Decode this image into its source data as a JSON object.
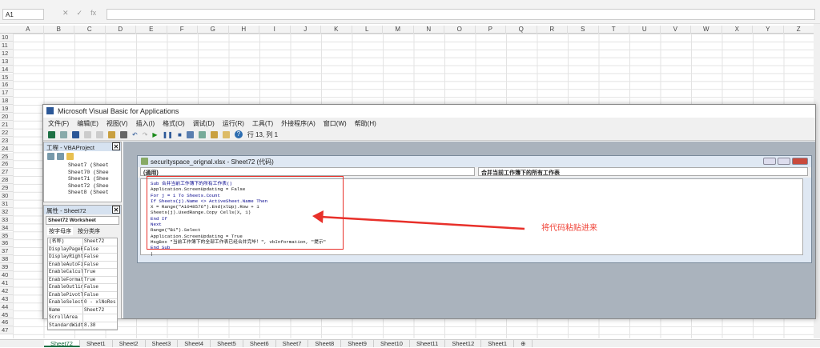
{
  "excel": {
    "name_box": "A1",
    "fx": "fx",
    "columns": [
      "A",
      "B",
      "C",
      "D",
      "E",
      "F",
      "G",
      "H",
      "I",
      "J",
      "K",
      "L",
      "M",
      "N",
      "O",
      "P",
      "Q",
      "R",
      "S",
      "T",
      "U",
      "V",
      "W",
      "X",
      "Y",
      "Z"
    ],
    "rows": [
      "10",
      "11",
      "12",
      "13",
      "14",
      "15",
      "16",
      "17",
      "18",
      "19",
      "20",
      "21",
      "22",
      "23",
      "24",
      "25",
      "26",
      "27",
      "28",
      "29",
      "30",
      "31",
      "32",
      "33",
      "34",
      "35",
      "36",
      "37",
      "38",
      "39",
      "40",
      "41",
      "42",
      "43",
      "44",
      "45",
      "46",
      "47"
    ],
    "sheet_tabs": [
      "Sheet72",
      "Sheet1",
      "Sheet2",
      "Sheet3",
      "Sheet4",
      "Sheet5",
      "Sheet6",
      "Sheet7",
      "Sheet8",
      "Sheet9",
      "Sheet10",
      "Sheet11",
      "Sheet12",
      "Sheet1"
    ],
    "add_sheet": "⊕"
  },
  "vba": {
    "title": "Microsoft Visual Basic for Applications",
    "menu": [
      "文件(F)",
      "编辑(E)",
      "视图(V)",
      "插入(I)",
      "格式(O)",
      "调试(D)",
      "运行(R)",
      "工具(T)",
      "外接程序(A)",
      "窗口(W)",
      "帮助(H)"
    ],
    "cursor_position": "行 13, 列 1",
    "project": {
      "title": "工程 - VBAProject",
      "items": [
        "Sheet7 (Sheet",
        "Sheet70 (Shee",
        "Sheet71 (Shee",
        "Sheet72 (Shee",
        "Sheet8 (Sheet"
      ]
    },
    "properties": {
      "title": "属性 - Sheet72",
      "object": "Sheet72 Worksheet",
      "tabs": [
        "按字母序",
        "按分类序"
      ],
      "rows": [
        [
          "(名称)",
          "Sheet72"
        ],
        [
          "DisplayPageBr",
          "False"
        ],
        [
          "DisplayRightT",
          "False"
        ],
        [
          "EnableAutoFil",
          "False"
        ],
        [
          "EnableCalcula",
          "True"
        ],
        [
          "EnableFormatC",
          "True"
        ],
        [
          "EnableOutlini",
          "False"
        ],
        [
          "EnablePivotTa",
          "False"
        ],
        [
          "EnableSelecti",
          "0 - xlNoRest"
        ],
        [
          "Name",
          "Sheet72"
        ],
        [
          "ScrollArea",
          ""
        ],
        [
          "StandardWidth",
          "8.38"
        ]
      ]
    },
    "code_window": {
      "title": "securityspace_orignal.xlsx - Sheet72 (代码)",
      "object_dropdown": "(通用)",
      "proc_dropdown": "合并当前工作簿下的所有工作表",
      "lines": [
        "Sub 合并当前工作簿下的所有工作表()",
        "Application.ScreenUpdating = False",
        "For j = 1 To Sheets.Count",
        "If Sheets(j).Name <> ActiveSheet.Name Then",
        "X = Range(\"A1048576\").End(xlUp).Row + 1",
        "Sheets(j).UsedRange.Copy Cells(X, 1)",
        "End If",
        "Next",
        "Range(\"B1\").Select",
        "Application.ScreenUpdating = True",
        "MsgBox \"当前工作簿下的全部工作表已经合并完毕！\", vbInformation, \"提示\"",
        "End Sub",
        "|"
      ]
    }
  },
  "annotation": {
    "text": "将代码粘贴进来",
    "color": "#f0453a"
  }
}
